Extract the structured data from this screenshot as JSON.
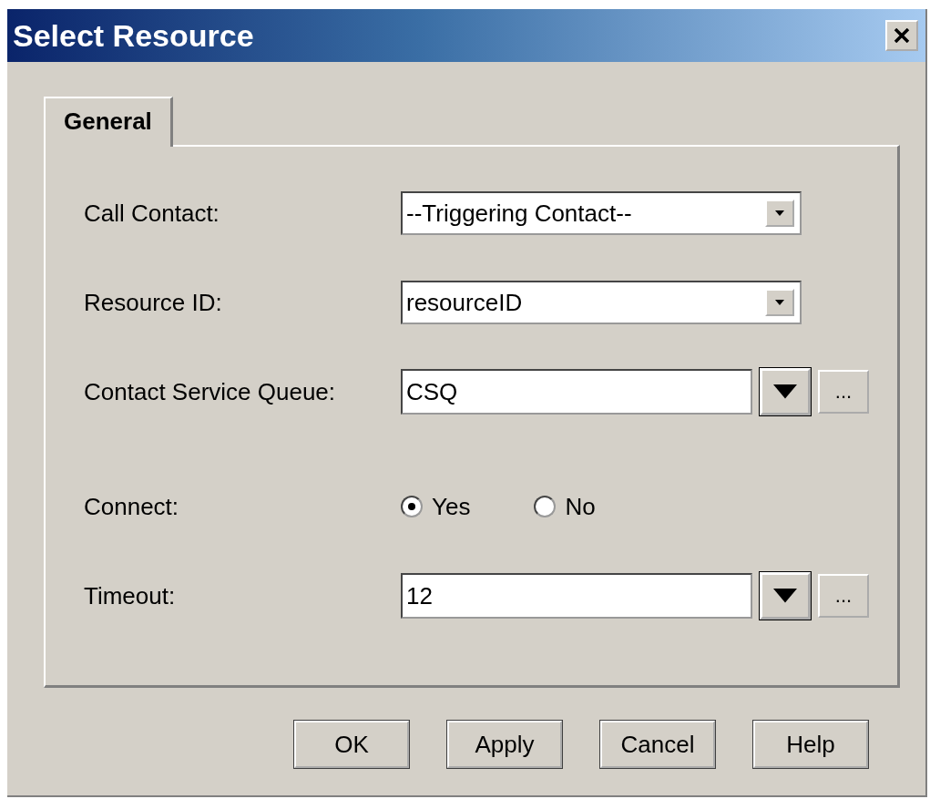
{
  "window": {
    "title": "Select Resource"
  },
  "tabs": [
    {
      "label": "General",
      "selected": true
    }
  ],
  "fields": [
    {
      "label": "Call Contact:",
      "kind": "combo",
      "value": "--Triggering Contact--"
    },
    {
      "label": "Resource ID:",
      "kind": "combo",
      "value": "resourceID"
    },
    {
      "label": "Contact Service Queue:",
      "kind": "expression",
      "value": "CSQ",
      "browse": "..."
    },
    {
      "label": "Connect:",
      "kind": "radio",
      "options": [
        {
          "label": "Yes",
          "selected": true
        },
        {
          "label": "No",
          "selected": false
        }
      ]
    },
    {
      "label": "Timeout:",
      "kind": "expression",
      "value": "12",
      "browse": "..."
    }
  ],
  "buttons": [
    "OK",
    "Apply",
    "Cancel",
    "Help"
  ]
}
